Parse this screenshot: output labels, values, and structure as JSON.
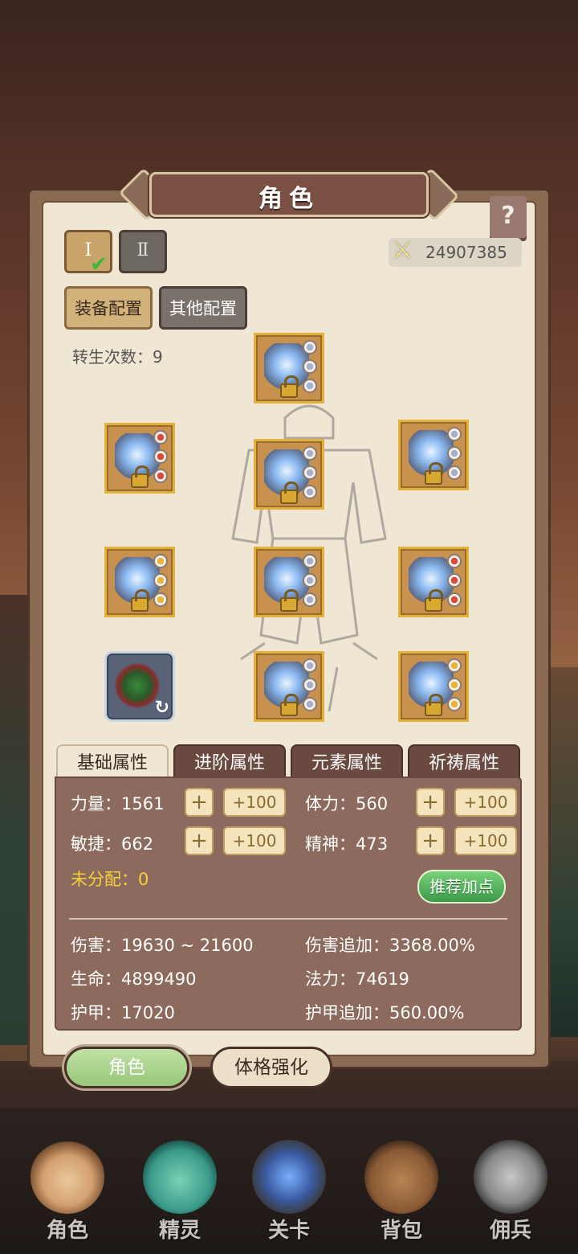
{
  "header": {
    "title": "角色",
    "help_icon": "?"
  },
  "tiers": [
    "Ⅰ",
    "Ⅱ"
  ],
  "combat_power": "24907385",
  "config_tabs": [
    "装备配置",
    "其他配置"
  ],
  "rebirth": "转生次数：9",
  "stat_tabs": [
    "基础属性",
    "进阶属性",
    "元素属性",
    "祈祷属性"
  ],
  "basic_stats": {
    "strength": "力量：1561",
    "stamina": "体力：560",
    "agility": "敏捷：662",
    "spirit": "精神：473",
    "unallocated": "未分配：0",
    "plus": "+",
    "plus100": "+100",
    "recommend": "推荐加点"
  },
  "derived_stats": {
    "damage": "伤害：19630 ~ 21600",
    "damage_bonus": "伤害追加：3368.00%",
    "life": "生命：4899490",
    "mana": "法力：74619",
    "armor": "护甲：17020",
    "armor_bonus": "护甲追加：560.00%"
  },
  "sub_buttons": [
    "角色",
    "体格强化"
  ],
  "nav": [
    "角色",
    "精灵",
    "关卡",
    "背包",
    "佣兵"
  ]
}
